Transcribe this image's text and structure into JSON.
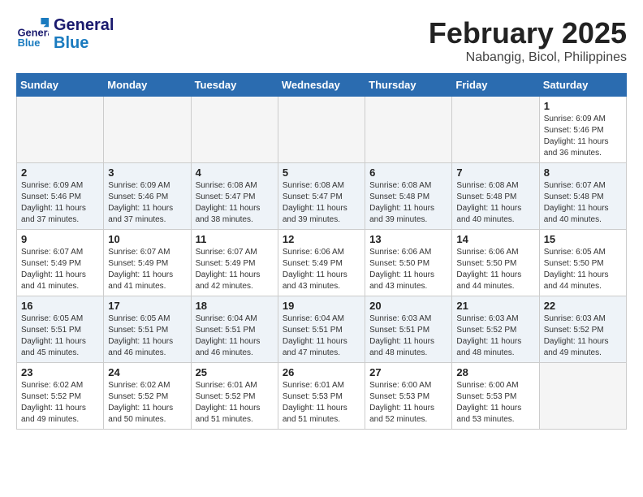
{
  "header": {
    "logo_line1": "General",
    "logo_line2": "Blue",
    "month": "February 2025",
    "location": "Nabangig, Bicol, Philippines"
  },
  "weekdays": [
    "Sunday",
    "Monday",
    "Tuesday",
    "Wednesday",
    "Thursday",
    "Friday",
    "Saturday"
  ],
  "weeks": [
    [
      {
        "day": "",
        "info": ""
      },
      {
        "day": "",
        "info": ""
      },
      {
        "day": "",
        "info": ""
      },
      {
        "day": "",
        "info": ""
      },
      {
        "day": "",
        "info": ""
      },
      {
        "day": "",
        "info": ""
      },
      {
        "day": "1",
        "info": "Sunrise: 6:09 AM\nSunset: 5:46 PM\nDaylight: 11 hours\nand 36 minutes."
      }
    ],
    [
      {
        "day": "2",
        "info": "Sunrise: 6:09 AM\nSunset: 5:46 PM\nDaylight: 11 hours\nand 37 minutes."
      },
      {
        "day": "3",
        "info": "Sunrise: 6:09 AM\nSunset: 5:46 PM\nDaylight: 11 hours\nand 37 minutes."
      },
      {
        "day": "4",
        "info": "Sunrise: 6:08 AM\nSunset: 5:47 PM\nDaylight: 11 hours\nand 38 minutes."
      },
      {
        "day": "5",
        "info": "Sunrise: 6:08 AM\nSunset: 5:47 PM\nDaylight: 11 hours\nand 39 minutes."
      },
      {
        "day": "6",
        "info": "Sunrise: 6:08 AM\nSunset: 5:48 PM\nDaylight: 11 hours\nand 39 minutes."
      },
      {
        "day": "7",
        "info": "Sunrise: 6:08 AM\nSunset: 5:48 PM\nDaylight: 11 hours\nand 40 minutes."
      },
      {
        "day": "8",
        "info": "Sunrise: 6:07 AM\nSunset: 5:48 PM\nDaylight: 11 hours\nand 40 minutes."
      }
    ],
    [
      {
        "day": "9",
        "info": "Sunrise: 6:07 AM\nSunset: 5:49 PM\nDaylight: 11 hours\nand 41 minutes."
      },
      {
        "day": "10",
        "info": "Sunrise: 6:07 AM\nSunset: 5:49 PM\nDaylight: 11 hours\nand 41 minutes."
      },
      {
        "day": "11",
        "info": "Sunrise: 6:07 AM\nSunset: 5:49 PM\nDaylight: 11 hours\nand 42 minutes."
      },
      {
        "day": "12",
        "info": "Sunrise: 6:06 AM\nSunset: 5:49 PM\nDaylight: 11 hours\nand 43 minutes."
      },
      {
        "day": "13",
        "info": "Sunrise: 6:06 AM\nSunset: 5:50 PM\nDaylight: 11 hours\nand 43 minutes."
      },
      {
        "day": "14",
        "info": "Sunrise: 6:06 AM\nSunset: 5:50 PM\nDaylight: 11 hours\nand 44 minutes."
      },
      {
        "day": "15",
        "info": "Sunrise: 6:05 AM\nSunset: 5:50 PM\nDaylight: 11 hours\nand 44 minutes."
      }
    ],
    [
      {
        "day": "16",
        "info": "Sunrise: 6:05 AM\nSunset: 5:51 PM\nDaylight: 11 hours\nand 45 minutes."
      },
      {
        "day": "17",
        "info": "Sunrise: 6:05 AM\nSunset: 5:51 PM\nDaylight: 11 hours\nand 46 minutes."
      },
      {
        "day": "18",
        "info": "Sunrise: 6:04 AM\nSunset: 5:51 PM\nDaylight: 11 hours\nand 46 minutes."
      },
      {
        "day": "19",
        "info": "Sunrise: 6:04 AM\nSunset: 5:51 PM\nDaylight: 11 hours\nand 47 minutes."
      },
      {
        "day": "20",
        "info": "Sunrise: 6:03 AM\nSunset: 5:51 PM\nDaylight: 11 hours\nand 48 minutes."
      },
      {
        "day": "21",
        "info": "Sunrise: 6:03 AM\nSunset: 5:52 PM\nDaylight: 11 hours\nand 48 minutes."
      },
      {
        "day": "22",
        "info": "Sunrise: 6:03 AM\nSunset: 5:52 PM\nDaylight: 11 hours\nand 49 minutes."
      }
    ],
    [
      {
        "day": "23",
        "info": "Sunrise: 6:02 AM\nSunset: 5:52 PM\nDaylight: 11 hours\nand 49 minutes."
      },
      {
        "day": "24",
        "info": "Sunrise: 6:02 AM\nSunset: 5:52 PM\nDaylight: 11 hours\nand 50 minutes."
      },
      {
        "day": "25",
        "info": "Sunrise: 6:01 AM\nSunset: 5:52 PM\nDaylight: 11 hours\nand 51 minutes."
      },
      {
        "day": "26",
        "info": "Sunrise: 6:01 AM\nSunset: 5:53 PM\nDaylight: 11 hours\nand 51 minutes."
      },
      {
        "day": "27",
        "info": "Sunrise: 6:00 AM\nSunset: 5:53 PM\nDaylight: 11 hours\nand 52 minutes."
      },
      {
        "day": "28",
        "info": "Sunrise: 6:00 AM\nSunset: 5:53 PM\nDaylight: 11 hours\nand 53 minutes."
      },
      {
        "day": "",
        "info": ""
      }
    ]
  ]
}
